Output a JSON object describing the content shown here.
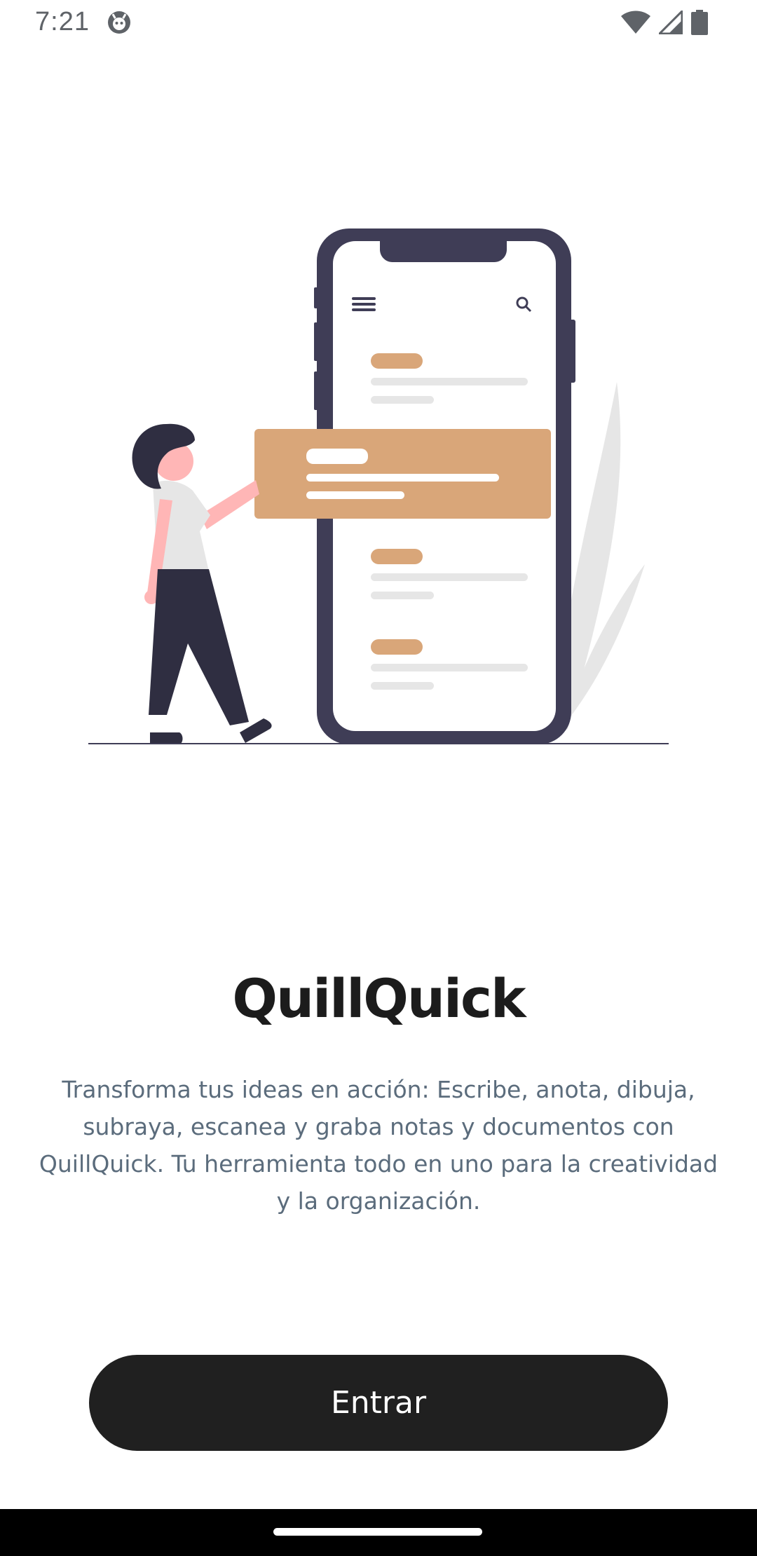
{
  "status_bar": {
    "time": "7:21",
    "notification_icon": "android-debug-icon",
    "icons": [
      "wifi-icon",
      "cellular-signal-icon",
      "battery-icon"
    ]
  },
  "illustration": {
    "description_icon": "person-with-phone-illustration",
    "colors": {
      "phone_frame": "#3f3d56",
      "accent": "#d9a679",
      "line": "#e6e6e6",
      "skin": "#ffb6b6",
      "leaf": "#e6e6e6",
      "hair": "#2f2e41"
    }
  },
  "main": {
    "title": "QuillQuick",
    "description": "Transforma tus ideas en acción: Escribe, anota, dibuja, subraya, escanea y graba notas y documentos con QuillQuick. Tu herramienta todo en uno para la creatividad y la organización.",
    "enter_label": "Entrar"
  },
  "theme": {
    "button_background": "#202020",
    "description_color": "#5b6c7c",
    "title_color": "#1c1c1c"
  }
}
